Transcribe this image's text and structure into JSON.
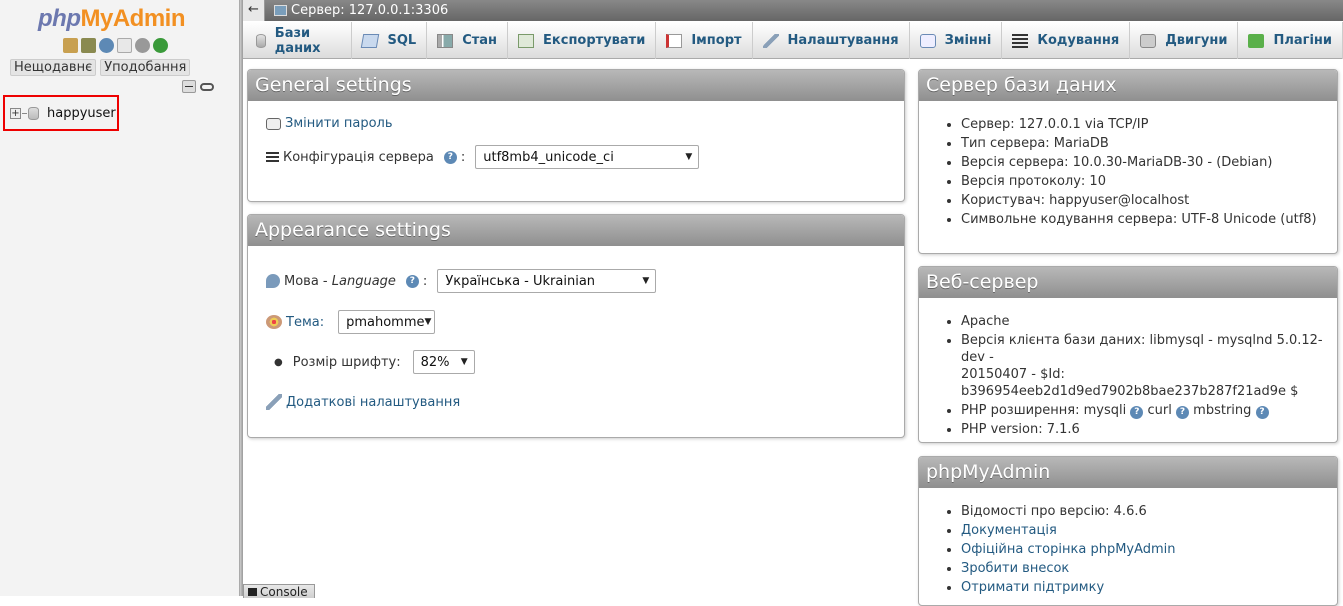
{
  "nav": {
    "logo_php": "php",
    "logo_my": "My",
    "logo_admin": "Admin",
    "recent_label": "Нещодавнє",
    "favorites_label": "Уподобання",
    "databases": [
      {
        "name": "happyuser"
      }
    ]
  },
  "topbar": {
    "back_label": "←",
    "server_label": "Сервер: 127.0.0.1:3306"
  },
  "tabs": [
    {
      "label": "Бази даних",
      "icon": "database-icon"
    },
    {
      "label": "SQL",
      "icon": "sql-icon"
    },
    {
      "label": "Стан",
      "icon": "status-icon"
    },
    {
      "label": "Експортувати",
      "icon": "export-icon"
    },
    {
      "label": "Імпорт",
      "icon": "import-icon"
    },
    {
      "label": "Налаштування",
      "icon": "wrench-icon"
    },
    {
      "label": "Змінні",
      "icon": "variables-icon"
    },
    {
      "label": "Кодування",
      "icon": "charset-icon"
    },
    {
      "label": "Двигуни",
      "icon": "engine-icon"
    },
    {
      "label": "Плагіни",
      "icon": "plugin-icon"
    }
  ],
  "general": {
    "title": "General settings",
    "change_password": "Змінити пароль",
    "collation_label": "Конфігурація сервера",
    "collation_value": "utf8mb4_unicode_ci"
  },
  "appearance": {
    "title": "Appearance settings",
    "language_label": "Мова - ",
    "language_label_italic": "Language",
    "language_value": "Українська - Ukrainian",
    "theme_label": "Тема:",
    "theme_value": "pmahomme",
    "font_label": "Розмір шрифту:",
    "font_value": "82%",
    "more_settings": "Додаткові налаштування"
  },
  "db_server": {
    "title": "Сервер бази даних",
    "items": [
      "Сервер: 127.0.0.1 via TCP/IP",
      "Тип сервера: MariaDB",
      "Версія сервера: 10.0.30-MariaDB-30 - (Debian)",
      "Версія протоколу: 10",
      "Користувач: happyuser@localhost",
      "Символьне кодування сервера: UTF-8 Unicode (utf8)"
    ]
  },
  "web_server": {
    "title": "Веб-сервер",
    "apache": "Apache",
    "client_line1": "Версія клієнта бази даних: libmysql - mysqlnd 5.0.12-dev -",
    "client_line2": "20150407 - $Id:",
    "client_line3": "b396954eeb2d1d9ed7902b8bae237b287f21ad9e $",
    "php_ext_label": "PHP розширення: ",
    "php_ext_1": "mysqli",
    "php_ext_2": "curl",
    "php_ext_3": "mbstring",
    "php_version": "PHP version: 7.1.6"
  },
  "pma": {
    "title": "phpMyAdmin",
    "version": "Відомості про версію: 4.6.6",
    "links": [
      "Документація",
      "Офіційна сторінка phpMyAdmin",
      "Зробити внесок",
      "Отримати підтримку"
    ]
  },
  "console_label": "Console",
  "colors": {
    "link": "#235a81",
    "header": "#999999",
    "highlight": "#ee0000"
  }
}
